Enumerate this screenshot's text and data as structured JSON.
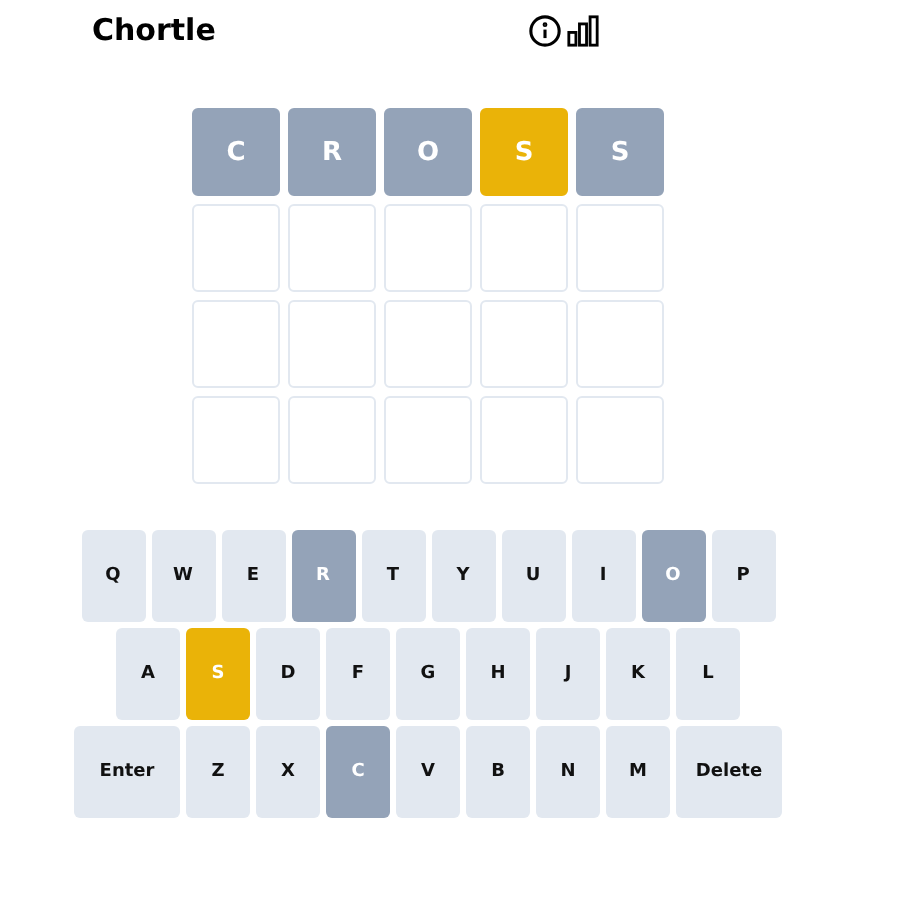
{
  "header": {
    "title": "Chortle"
  },
  "board": [
    [
      {
        "letter": "C",
        "present": false
      },
      {
        "letter": "R",
        "present": false
      },
      {
        "letter": "O",
        "present": false
      },
      {
        "letter": "S",
        "present": true
      },
      {
        "letter": "S",
        "present": false
      }
    ],
    [
      {
        "present": false
      },
      {
        "present": false
      },
      {
        "present": false
      },
      {
        "present": false
      },
      {
        "present": false
      }
    ],
    [
      {
        "present": false
      },
      {
        "present": false
      },
      {
        "present": false
      },
      {
        "present": false
      },
      {
        "present": false
      }
    ],
    [
      {
        "present": false
      },
      {
        "present": false
      },
      {
        "present": false
      },
      {
        "present": false
      },
      {
        "present": false
      }
    ]
  ],
  "keyboard": [
    [
      {
        "label": "Q",
        "guessed": false,
        "present": false
      },
      {
        "label": "W",
        "guessed": false,
        "present": false
      },
      {
        "label": "E",
        "guessed": false,
        "present": false
      },
      {
        "label": "R",
        "guessed": true,
        "present": false
      },
      {
        "label": "T",
        "guessed": false,
        "present": false
      },
      {
        "label": "Y",
        "guessed": false,
        "present": false
      },
      {
        "label": "U",
        "guessed": false,
        "present": false
      },
      {
        "label": "I",
        "guessed": false,
        "present": false
      },
      {
        "label": "O",
        "guessed": true,
        "present": false
      },
      {
        "label": "P",
        "guessed": false,
        "present": false
      }
    ],
    [
      {
        "label": "A",
        "guessed": false,
        "present": false
      },
      {
        "label": "S",
        "guessed": true,
        "present": true
      },
      {
        "label": "D",
        "guessed": false,
        "present": false
      },
      {
        "label": "F",
        "guessed": false,
        "present": false
      },
      {
        "label": "G",
        "guessed": false,
        "present": false
      },
      {
        "label": "H",
        "guessed": false,
        "present": false
      },
      {
        "label": "J",
        "guessed": false,
        "present": false
      },
      {
        "label": "K",
        "guessed": false,
        "present": false
      },
      {
        "label": "L",
        "guessed": false,
        "present": false
      }
    ],
    [
      {
        "label": "Enter",
        "guessed": false,
        "present": false,
        "kind": "wide"
      },
      {
        "label": "Z",
        "guessed": false,
        "present": false
      },
      {
        "label": "X",
        "guessed": false,
        "present": false
      },
      {
        "label": "C",
        "guessed": true,
        "present": false
      },
      {
        "label": "V",
        "guessed": false,
        "present": false
      },
      {
        "label": "B",
        "guessed": false,
        "present": false
      },
      {
        "label": "N",
        "guessed": false,
        "present": false
      },
      {
        "label": "M",
        "guessed": false,
        "present": false
      },
      {
        "label": "Delete",
        "guessed": false,
        "present": false,
        "kind": "wide"
      }
    ]
  ]
}
